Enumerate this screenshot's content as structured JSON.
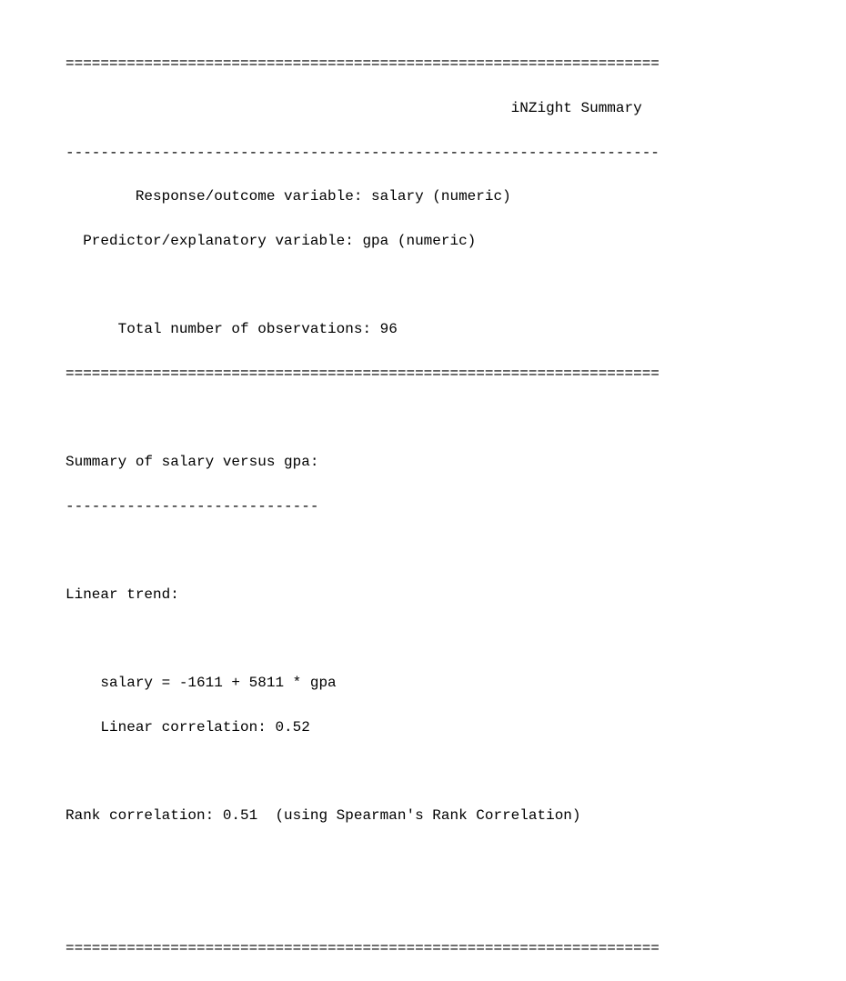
{
  "sep_double": "====================================================================",
  "title_line": "                                                   iNZight Summary",
  "sep_single": "--------------------------------------------------------------------",
  "response_line": "        Response/outcome variable: salary (numeric)",
  "predictor_line": "  Predictor/explanatory variable: gpa (numeric)",
  "nobs_line": "      Total number of observations: 96",
  "summary_title": "Summary of salary versus gpa:",
  "summary_underline": "-----------------------------",
  "linear_trend_title": "Linear trend:",
  "equation_line": "    salary = -1611 + 5811 * gpa",
  "lincorr_line": "    Linear correlation: 0.52",
  "rankcorr_line": "Rank correlation: 0.51  (using Spearman's Rank Correlation)"
}
